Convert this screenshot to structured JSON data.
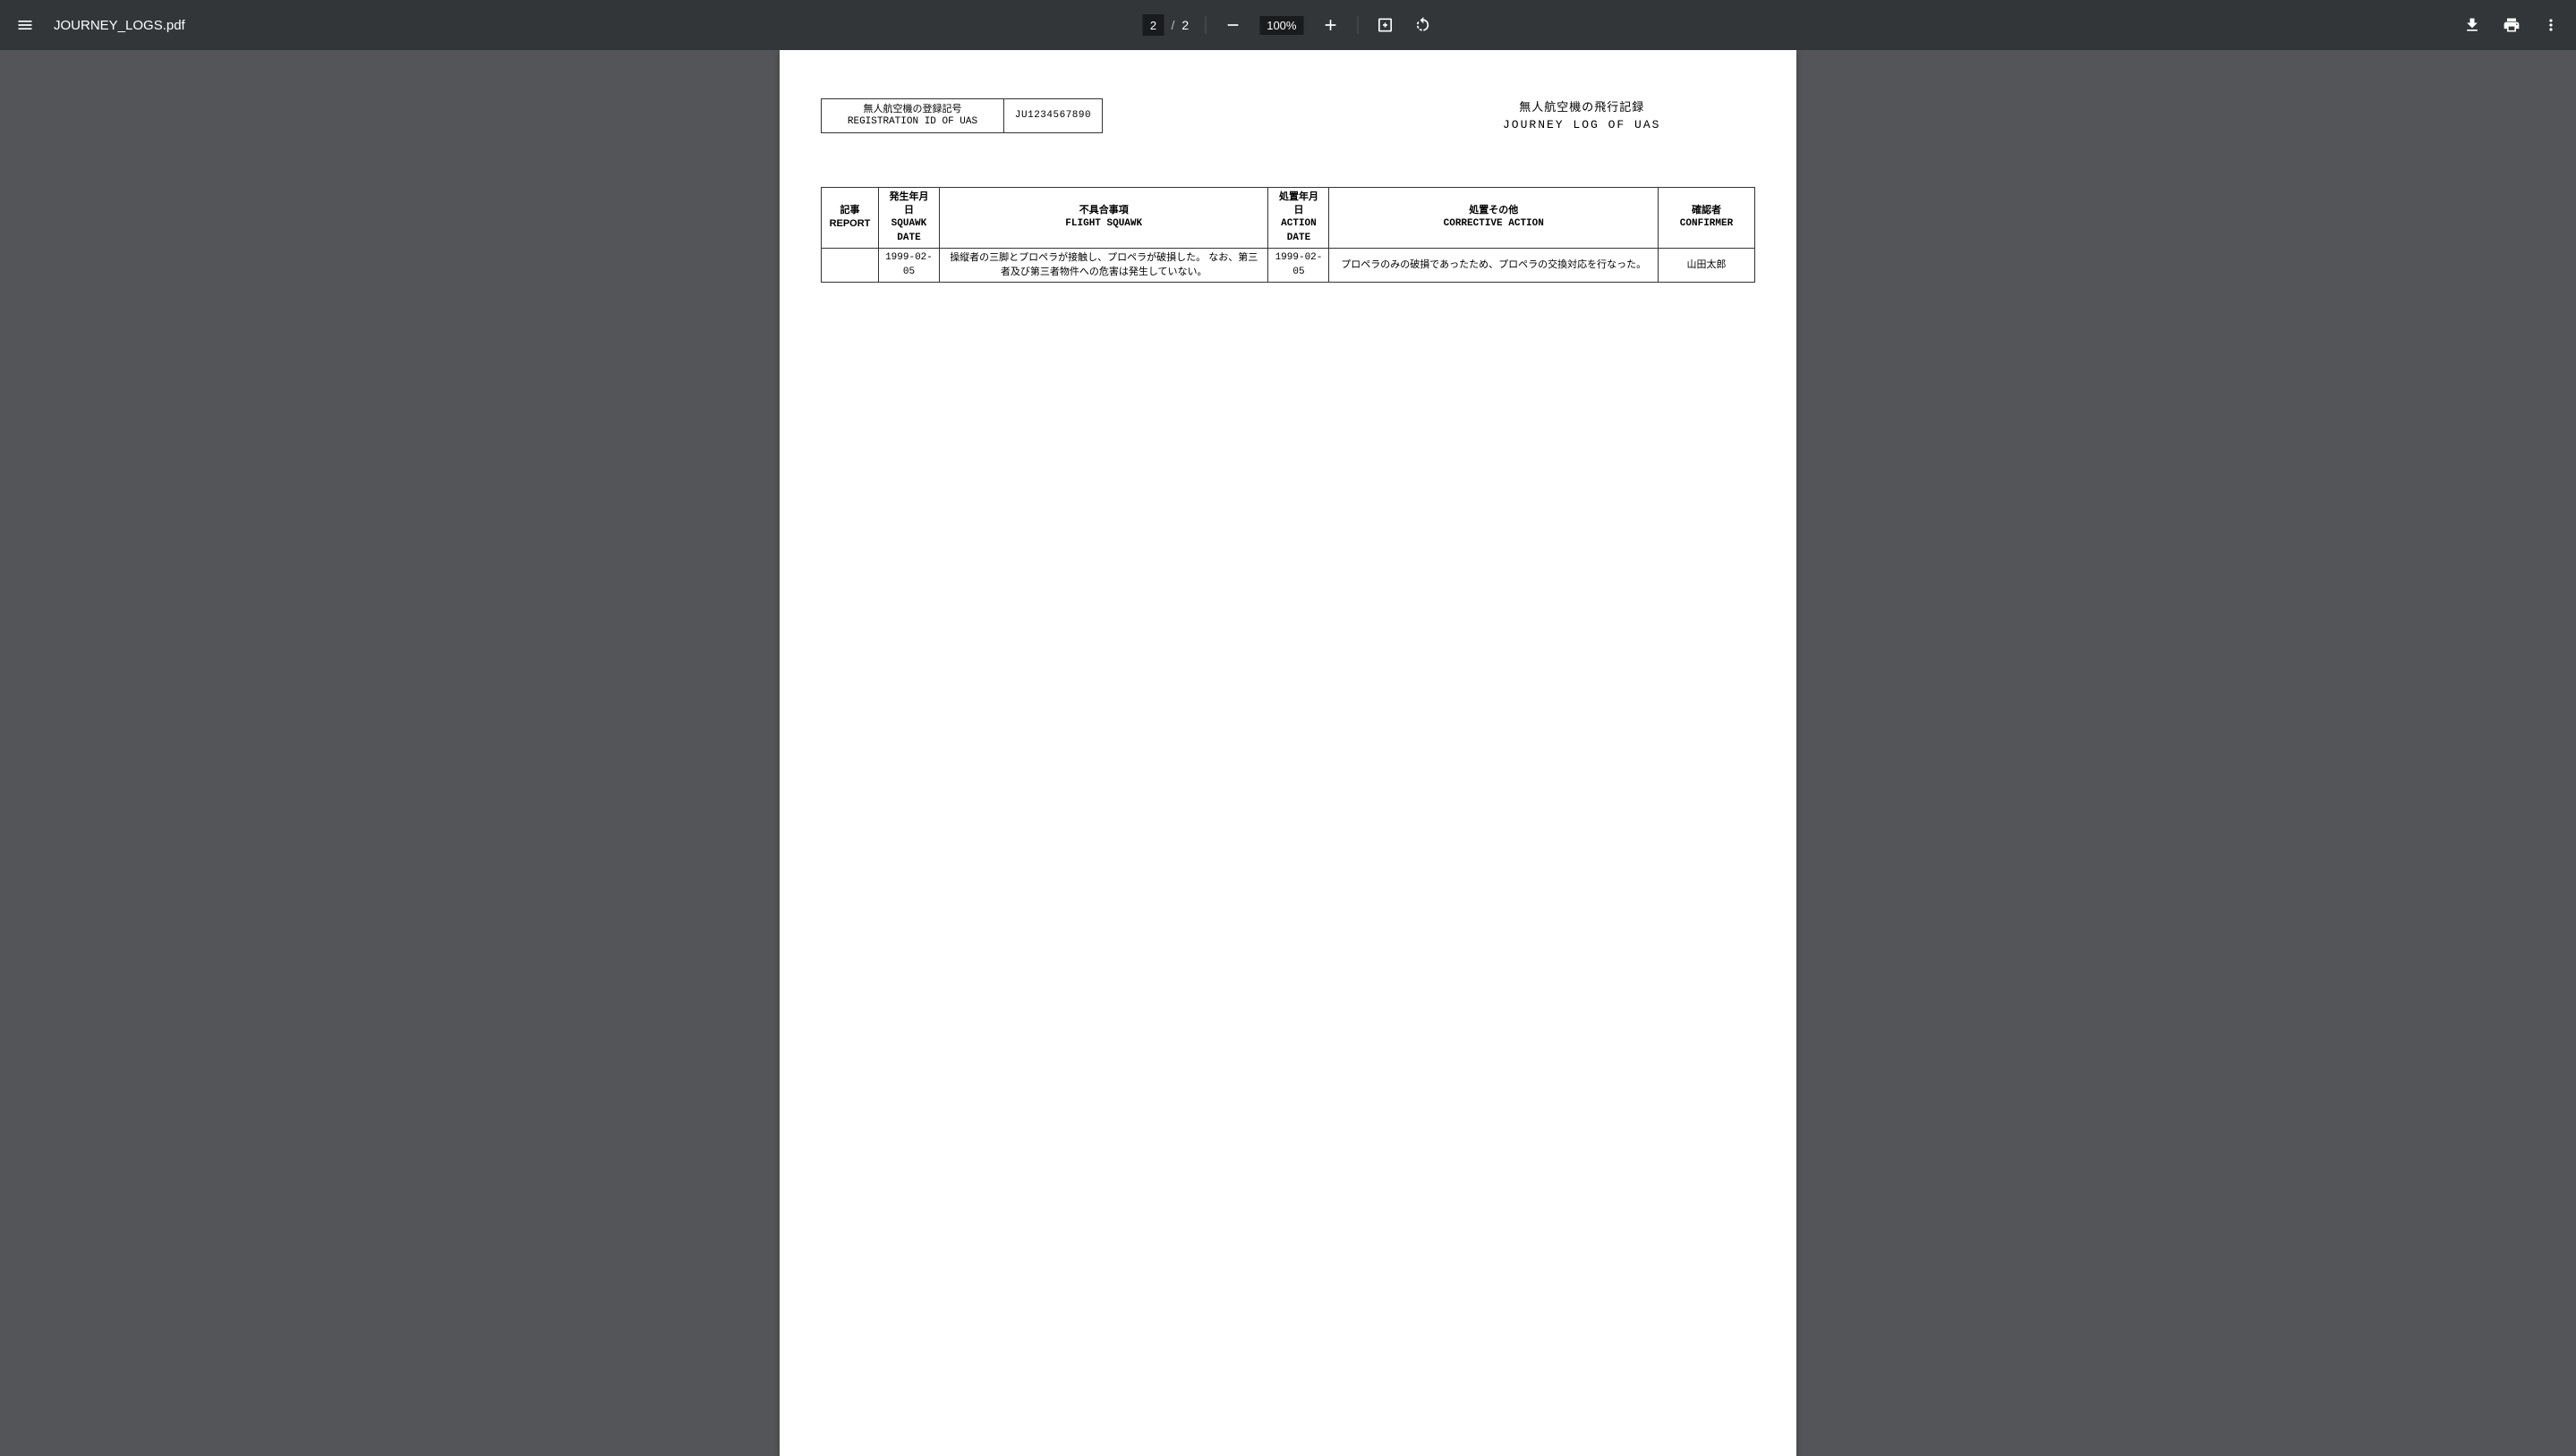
{
  "toolbar": {
    "filename": "JOURNEY_LOGS.pdf",
    "page_current": "2",
    "page_separator": "/",
    "page_total": "2",
    "zoom": "100%"
  },
  "document": {
    "registration": {
      "label_jp": "無人航空機の登録記号",
      "label_en": "REGISTRATION ID OF UAS",
      "value": "JU1234567890"
    },
    "title": {
      "jp": "無人航空機の飛行記録",
      "en": "JOURNEY LOG OF UAS"
    },
    "report_table": {
      "headers": {
        "report": "記事 REPORT",
        "squawk_date_jp": "発生年月日",
        "squawk_date_en": "SQUAWK DATE",
        "flight_squawk_jp": "不具合事項",
        "flight_squawk_en": "FLIGHT SQUAWK",
        "action_date_jp": "処置年月日",
        "action_date_en": "ACTION DATE",
        "corrective_jp": "処置その他",
        "corrective_en": "CORRECTIVE ACTION",
        "confirmer_jp": "確認者",
        "confirmer_en": "CONFIRMER"
      },
      "rows": [
        {
          "squawk_date": "1999-02-05",
          "flight_squawk": "操縦者の三脚とプロペラが接触し、プロペラが破損した。 なお、第三者及び第三者物件への危害は発生していない。",
          "action_date": "1999-02-05",
          "corrective_action": "プロペラのみの破損であったため、プロペラの交換対応を行なった。",
          "confirmer": "山田太郎"
        }
      ]
    }
  }
}
